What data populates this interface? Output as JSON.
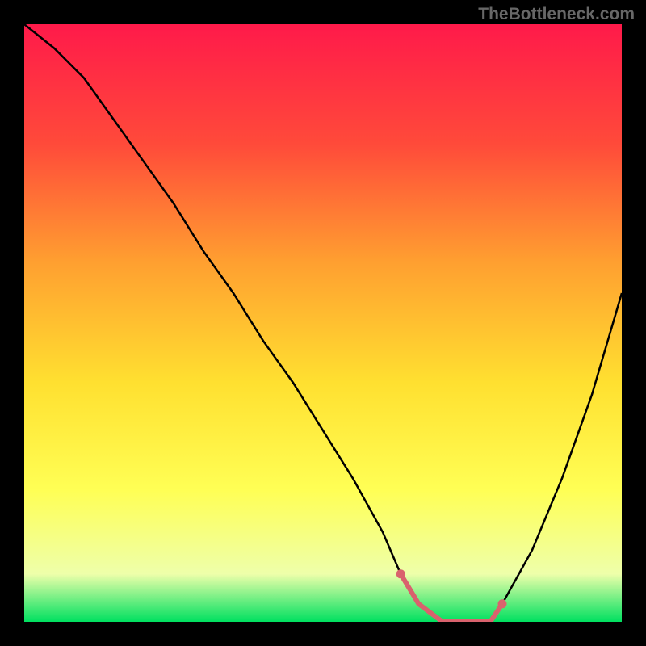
{
  "watermark": "TheBottleneck.com",
  "chart_data": {
    "type": "line",
    "title": "",
    "xlabel": "",
    "ylabel": "",
    "xlim": [
      0,
      100
    ],
    "ylim": [
      0,
      100
    ],
    "gradient_stops": [
      {
        "offset": 0,
        "color": "#ff1a4a"
      },
      {
        "offset": 20,
        "color": "#ff4a3a"
      },
      {
        "offset": 40,
        "color": "#ffa030"
      },
      {
        "offset": 60,
        "color": "#ffe030"
      },
      {
        "offset": 78,
        "color": "#ffff55"
      },
      {
        "offset": 92,
        "color": "#eeffaa"
      },
      {
        "offset": 100,
        "color": "#00e060"
      }
    ],
    "series": [
      {
        "name": "bottleneck-curve",
        "color": "#000000",
        "x": [
          0,
          5,
          10,
          15,
          20,
          25,
          30,
          35,
          40,
          45,
          50,
          55,
          60,
          63,
          66,
          70,
          74,
          78,
          80,
          85,
          90,
          95,
          100
        ],
        "y": [
          100,
          96,
          91,
          84,
          77,
          70,
          62,
          55,
          47,
          40,
          32,
          24,
          15,
          8,
          3,
          0,
          0,
          0,
          3,
          12,
          24,
          38,
          55
        ]
      },
      {
        "name": "highlight-segment",
        "color": "#d9626d",
        "x": [
          63,
          66,
          70,
          74,
          78,
          80
        ],
        "y": [
          8,
          3,
          0,
          0,
          0,
          3
        ],
        "dots_x": [
          63,
          80
        ],
        "dots_y": [
          8,
          3
        ]
      }
    ]
  }
}
